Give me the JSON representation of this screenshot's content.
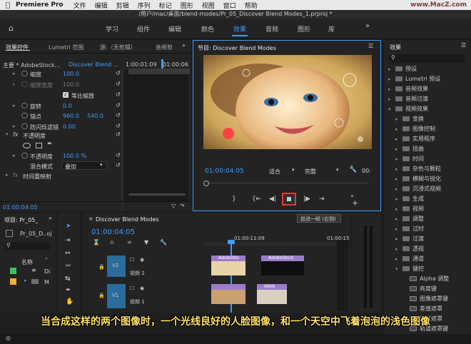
{
  "menubar": {
    "app": "Premiere Pro",
    "items": [
      "文件",
      "编辑",
      "剪辑",
      "序列",
      "标记",
      "图形",
      "视图",
      "窗口",
      "帮助"
    ],
    "watermark": "www.MacZ.com"
  },
  "window": {
    "path": "/用户/mac/桌面/blend-modes/Pr_05_Discover Blend Modes_1.prproj *"
  },
  "workspaces": {
    "items": [
      "学习",
      "组件",
      "编辑",
      "颜色",
      "效果",
      "音频",
      "图形",
      "库"
    ],
    "active": "效果"
  },
  "effect_controls": {
    "tabs": [
      "效果控件",
      "Lumetri 范围",
      "源:（无剪辑）",
      "音频剪"
    ],
    "master": "主要 * AdobeStock...",
    "clip": "Discover Blend ...",
    "timecodes": [
      "1:00:01:09",
      "01:00:06"
    ],
    "rows": [
      {
        "label": "缩放",
        "value": "100.0"
      },
      {
        "label": "缩放宽度",
        "value": "100.0"
      },
      {
        "label": "等比缩放",
        "value": ""
      },
      {
        "label": "旋转",
        "value": "0.0"
      },
      {
        "label": "锚点",
        "value": "960.0",
        "value2": "540.0"
      },
      {
        "label": "防闪烁滤镜",
        "value": "0.00"
      }
    ],
    "fx_opacity": "不透明度",
    "opacity_label": "不透明度",
    "opacity_value": "100.0 %",
    "blend_label": "混合模式",
    "blend_value": "叠加",
    "time_remap": "时间重映射",
    "current_time": "01:00:04:05"
  },
  "program": {
    "title": "节目: Discover Blend Modes",
    "timecode": "01:00:04:05",
    "fit": "适合",
    "quality": "完整",
    "end_timecode": "00:"
  },
  "project": {
    "tab": "项目: Pr_05_",
    "file": "Pr_05_D..oj",
    "name_header": "名称",
    "items": [
      "Di",
      "M"
    ]
  },
  "timeline": {
    "tab": "Discover Blend Modes",
    "timecode": "01:00:04:05",
    "ruler": [
      "01:00:11:09",
      "01:00:15"
    ],
    "tooltip": "前进一帧 (右侧)",
    "tracks": [
      {
        "id": "V2",
        "name": "视频 2"
      },
      {
        "id": "V1",
        "name": "视频 1"
      }
    ],
    "clips": [
      "AdobeSto",
      "AdobeStock",
      "Adob"
    ]
  },
  "effects_panel": {
    "title": "效果",
    "items": [
      "预设",
      "Lumetri 预设",
      "音频效果",
      "音频过渡",
      "视频效果",
      "变换",
      "图像控制",
      "实用程序",
      "扭曲",
      "时间",
      "杂色与颗粒",
      "模糊与锐化",
      "沉浸式视频",
      "生成",
      "视频",
      "调整",
      "过时",
      "过渡",
      "透视",
      "通道",
      "键控",
      "Alpha 调整",
      "亮度键",
      "图像遮罩键",
      "差值遮罩",
      "移除遮罩",
      "轨道遮罩键"
    ]
  },
  "caption": "当合成这样的两个图像时，一个光线良好的人脸图像，和一个天空中飞着泡泡的浅色图像",
  "colors": {
    "accent": "#3f9cff",
    "v_track": "#2a6c9c",
    "clip_pink": "#9b7cc9",
    "caption": "#ffe066"
  }
}
